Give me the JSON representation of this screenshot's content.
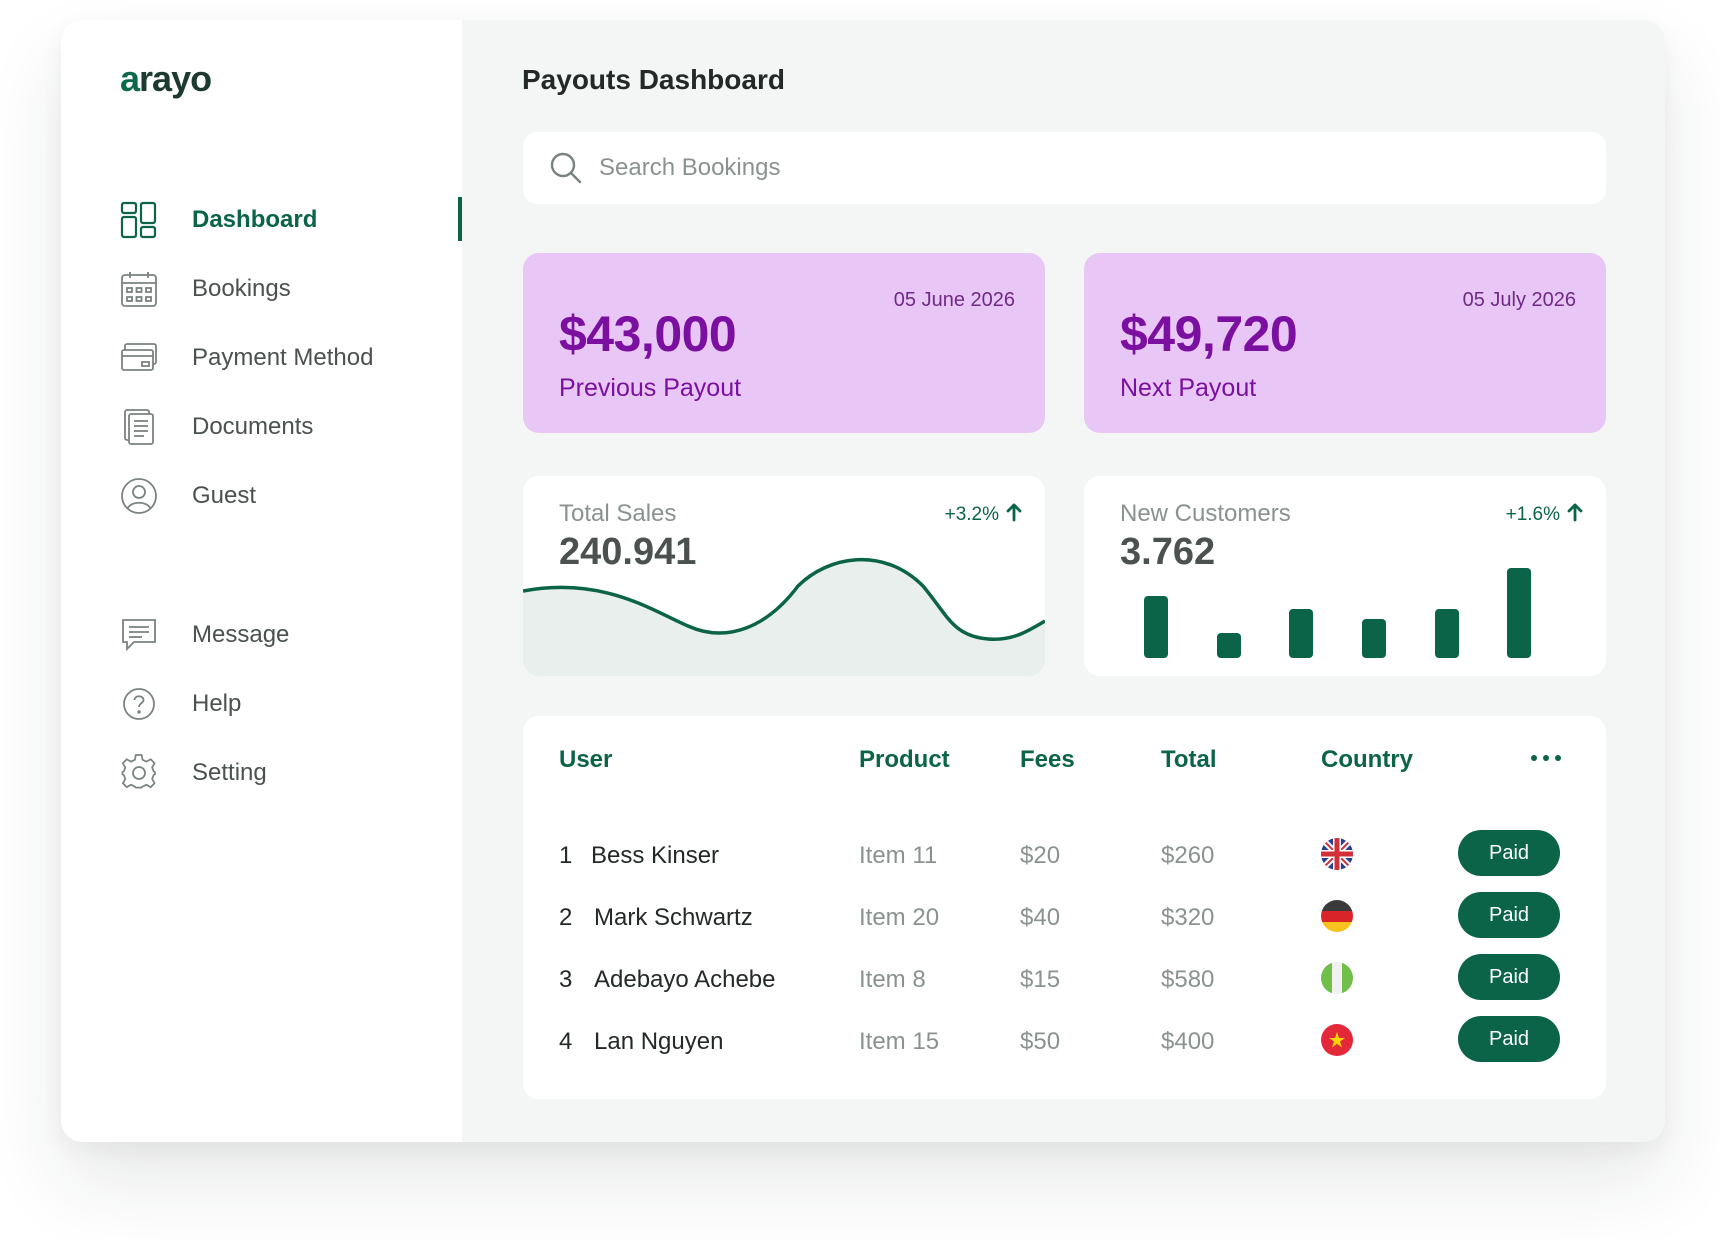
{
  "app": {
    "logo_prefix": "a",
    "logo_rest": "rayo"
  },
  "sidebar": {
    "items": [
      {
        "label": "Dashboard",
        "icon": "grid-icon",
        "active": true
      },
      {
        "label": "Bookings",
        "icon": "calendar-icon"
      },
      {
        "label": "Payment Method",
        "icon": "credit-card-icon"
      },
      {
        "label": "Documents",
        "icon": "document-icon"
      },
      {
        "label": "Guest",
        "icon": "user-icon"
      },
      {
        "label": "Message",
        "icon": "message-icon"
      },
      {
        "label": "Help",
        "icon": "help-icon"
      },
      {
        "label": "Setting",
        "icon": "gear-icon"
      }
    ]
  },
  "main": {
    "title": "Payouts Dashboard",
    "search": {
      "placeholder": "Search Bookings"
    },
    "payouts": [
      {
        "amount": "$43,000",
        "caption": "Previous Payout",
        "date": "05 June 2026"
      },
      {
        "amount": "$49,720",
        "caption": "Next Payout",
        "date": "05 July 2026"
      }
    ],
    "stats": [
      {
        "title": "Total Sales",
        "value": "240.941",
        "change": "+3.2%"
      },
      {
        "title": "New Customers",
        "value": "3.762",
        "change": "+1.6%"
      }
    ],
    "table": {
      "headers": {
        "user": "User",
        "product": "Product",
        "fees": "Fees",
        "total": "Total",
        "country": "Country"
      },
      "rows": [
        {
          "num": "1",
          "user": "Bess Kinser",
          "product": "Item 11",
          "fees": "$20",
          "total": "$260",
          "country_flag": "uk-flag-icon",
          "status": "Paid"
        },
        {
          "num": "2",
          "user": "Mark Schwartz",
          "product": "Item 20",
          "fees": "$40",
          "total": "$320",
          "country_flag": "germany-flag-icon",
          "status": "Paid"
        },
        {
          "num": "3",
          "user": "Adebayo Achebe",
          "product": "Item 8",
          "fees": "$15",
          "total": "$580",
          "country_flag": "nigeria-flag-icon",
          "status": "Paid"
        },
        {
          "num": "4",
          "user": "Lan Nguyen",
          "product": "Item 15",
          "fees": "$50",
          "total": "$400",
          "country_flag": "vietnam-flag-icon",
          "status": "Paid"
        }
      ]
    }
  },
  "colors": {
    "brand_green": "#0b6448",
    "payout_bg": "#e8c6f5",
    "payout_text": "#7a0fa0",
    "main_bg": "#f4f6f5"
  }
}
